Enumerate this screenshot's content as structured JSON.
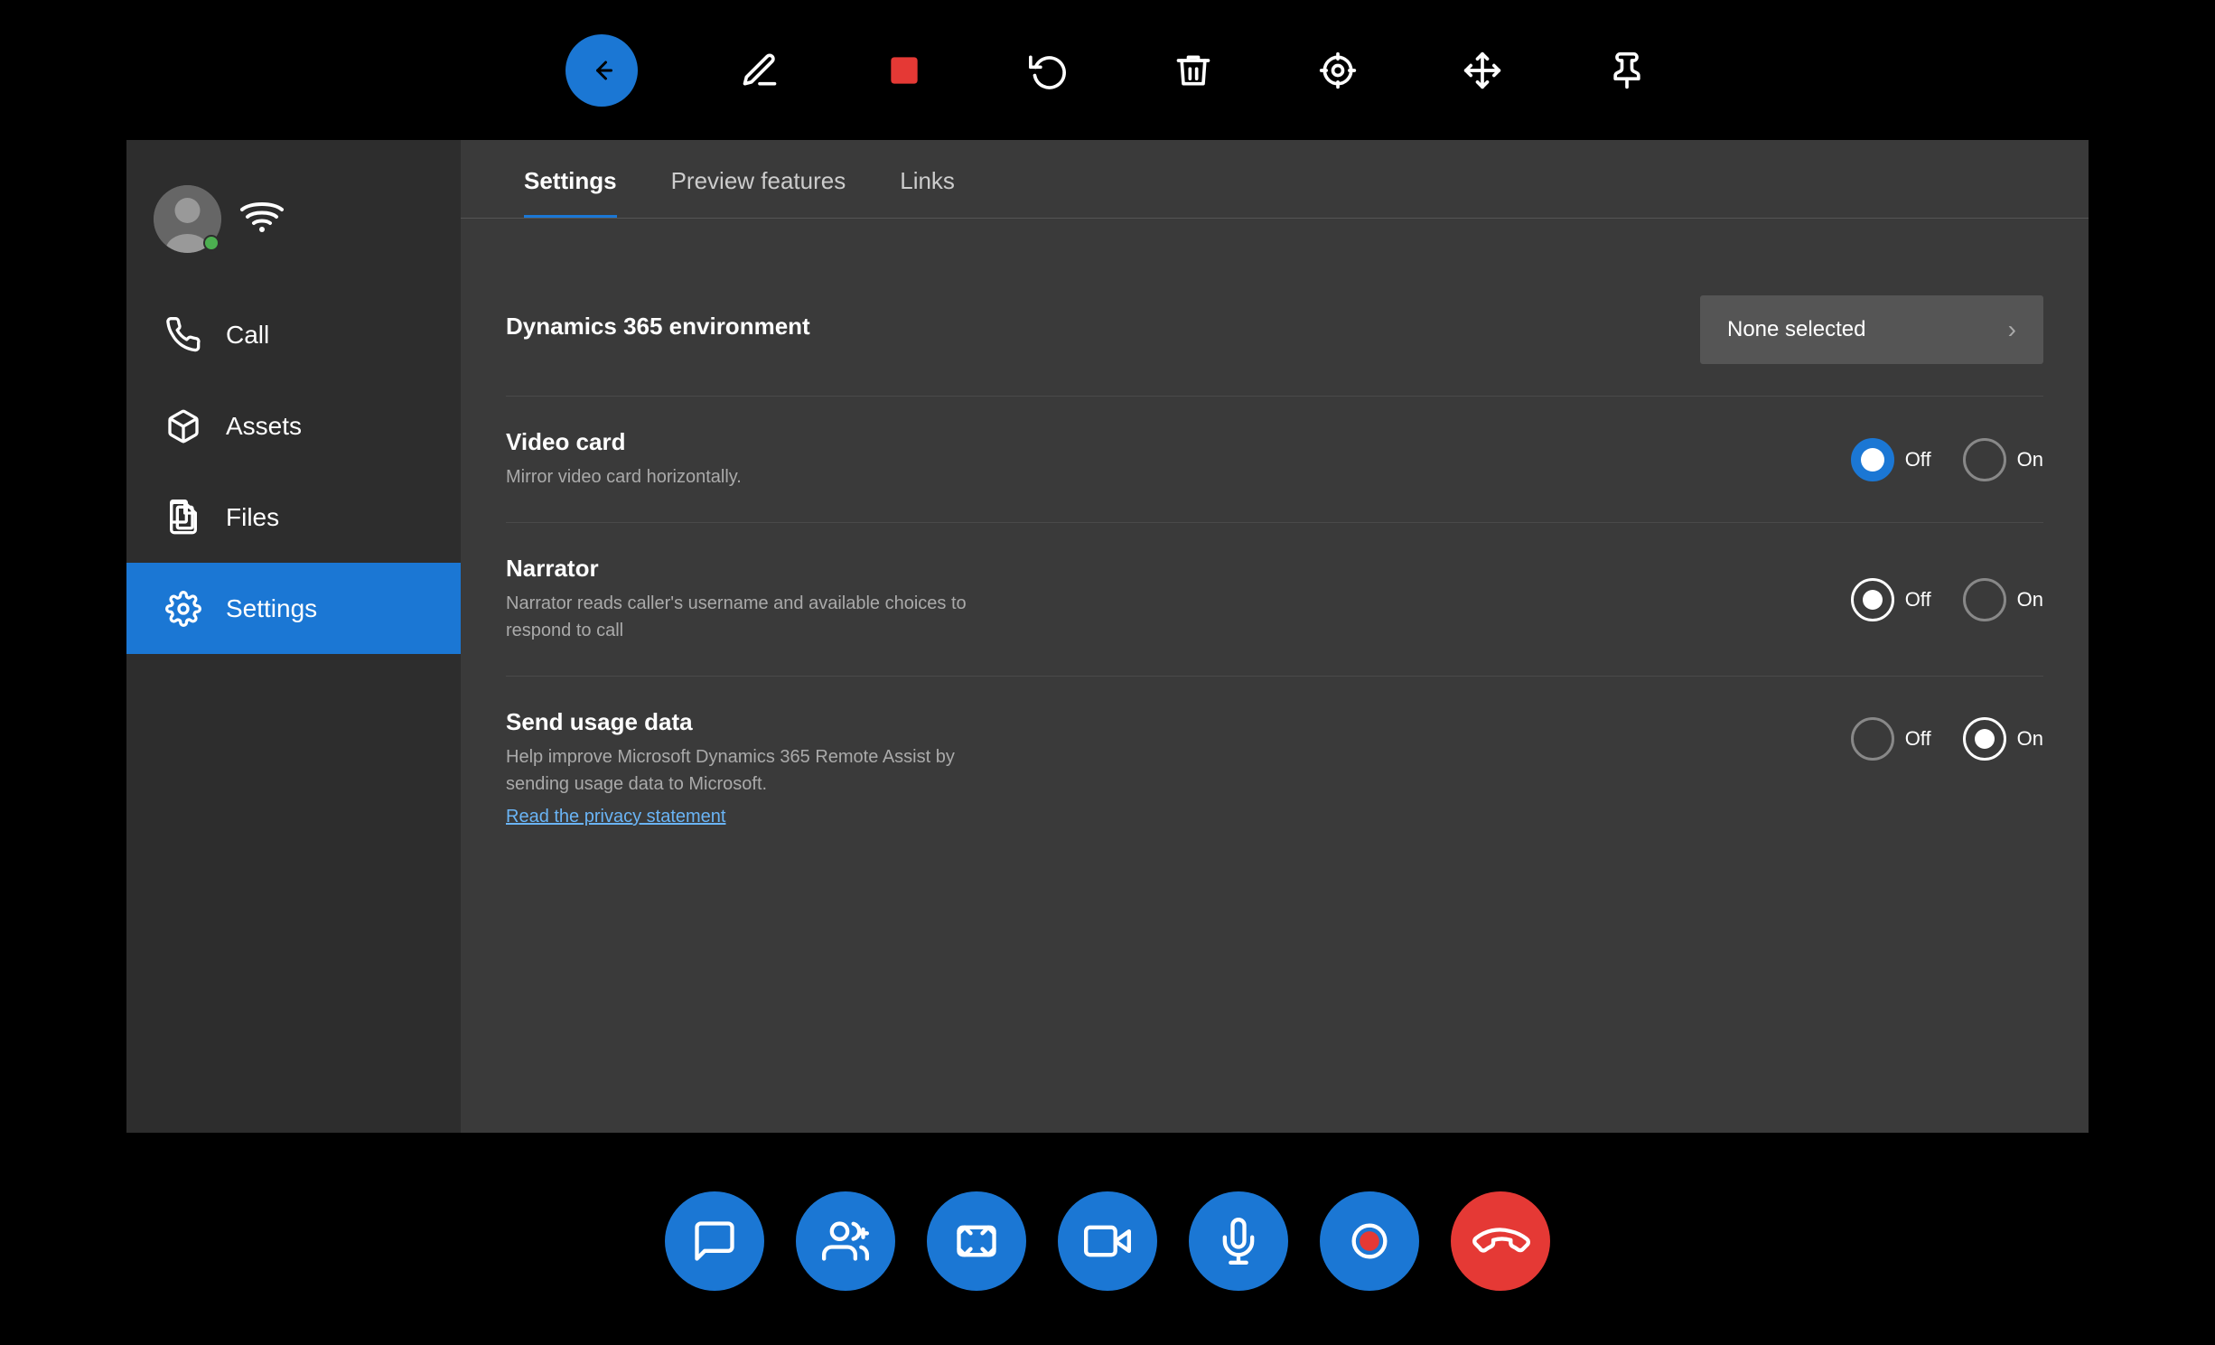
{
  "toolbar": {
    "icons": [
      {
        "name": "back-icon",
        "label": "←"
      },
      {
        "name": "pen-icon",
        "label": "✏"
      },
      {
        "name": "stop-icon",
        "label": "■"
      },
      {
        "name": "undo-icon",
        "label": "↺"
      },
      {
        "name": "delete-icon",
        "label": "🗑"
      },
      {
        "name": "location-icon",
        "label": "◎"
      },
      {
        "name": "move-icon",
        "label": "✛"
      },
      {
        "name": "pin-icon",
        "label": "📌"
      }
    ]
  },
  "sidebar": {
    "nav_items": [
      {
        "id": "call",
        "label": "Call",
        "active": false
      },
      {
        "id": "assets",
        "label": "Assets",
        "active": false
      },
      {
        "id": "files",
        "label": "Files",
        "active": false
      },
      {
        "id": "settings",
        "label": "Settings",
        "active": true
      }
    ]
  },
  "settings": {
    "tabs": [
      {
        "id": "settings",
        "label": "Settings",
        "active": true
      },
      {
        "id": "preview",
        "label": "Preview features",
        "active": false
      },
      {
        "id": "links",
        "label": "Links",
        "active": false
      }
    ],
    "environment": {
      "label": "Dynamics 365 environment",
      "value": "None selected",
      "placeholder": "None selected"
    },
    "video_card": {
      "label": "Video card",
      "description": "Mirror video card horizontally.",
      "off_selected": true,
      "on_selected": false
    },
    "narrator": {
      "label": "Narrator",
      "description": "Narrator reads caller's username and available choices to respond to call",
      "off_selected": true,
      "on_selected": false
    },
    "send_usage": {
      "label": "Send usage data",
      "description": "Help improve Microsoft Dynamics 365 Remote Assist by sending usage data to Microsoft.",
      "off_selected": false,
      "on_selected": true,
      "privacy_link": "Read the privacy statement"
    }
  },
  "bottom_toolbar": {
    "buttons": [
      {
        "name": "chat-button",
        "label": "chat"
      },
      {
        "name": "participants-button",
        "label": "participants"
      },
      {
        "name": "screenshot-button",
        "label": "screenshot"
      },
      {
        "name": "video-button",
        "label": "video"
      },
      {
        "name": "mic-button",
        "label": "mic"
      },
      {
        "name": "record-button",
        "label": "record"
      },
      {
        "name": "end-call-button",
        "label": "end",
        "red": true
      }
    ]
  },
  "labels": {
    "off": "Off",
    "on": "On",
    "chevron": "›"
  }
}
